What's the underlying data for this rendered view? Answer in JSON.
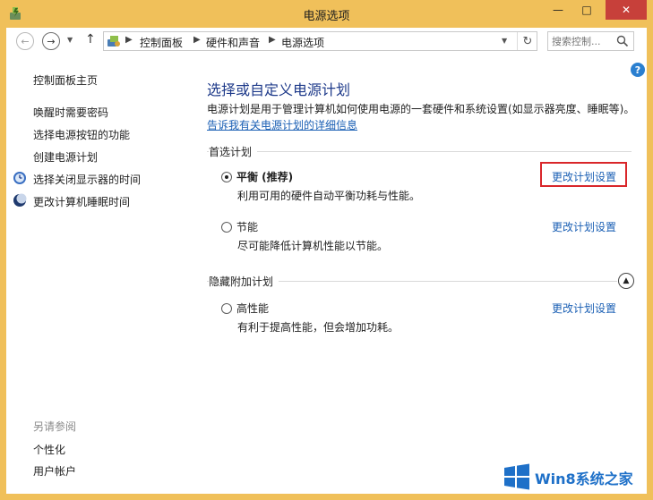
{
  "window": {
    "title": "电源选项",
    "minimize_glyph": "—",
    "maximize_glyph": "□",
    "close_glyph": "✕"
  },
  "address": {
    "breadcrumbs": [
      "控制面板",
      "硬件和声音",
      "电源选项"
    ],
    "search_placeholder": "搜索控制..."
  },
  "sidebar": {
    "home": "控制面板主页",
    "links": [
      "唤醒时需要密码",
      "选择电源按钮的功能",
      "创建电源计划",
      "选择关闭显示器的时间",
      "更改计算机睡眠时间"
    ],
    "see_also": "另请参阅",
    "see_also_links": [
      "个性化",
      "用户帐户"
    ]
  },
  "main": {
    "title": "选择或自定义电源计划",
    "description": "电源计划是用于管理计算机如何使用电源的一套硬件和系统设置(如显示器亮度、睡眠等)。",
    "info_link": "告诉我有关电源计划的详细信息",
    "preferred_label": "首选计划",
    "plans": [
      {
        "name": "平衡 (推荐)",
        "desc": "利用可用的硬件自动平衡功耗与性能。",
        "link": "更改计划设置",
        "selected": true
      },
      {
        "name": "节能",
        "desc": "尽可能降低计算机性能以节能。",
        "link": "更改计划设置",
        "selected": false
      }
    ],
    "hidden_label": "隐藏附加计划",
    "hidden_plans": [
      {
        "name": "高性能",
        "desc": "有利于提高性能，但会增加功耗。",
        "link": "更改计划设置",
        "selected": false
      }
    ]
  },
  "help_glyph": "?",
  "watermark": {
    "text": "Win8系统之家"
  },
  "colors": {
    "frame": "#f0c05a",
    "link": "#1a5fb4",
    "title": "#1e3a8a",
    "highlight": "#d9262a",
    "close": "#c7403a"
  }
}
